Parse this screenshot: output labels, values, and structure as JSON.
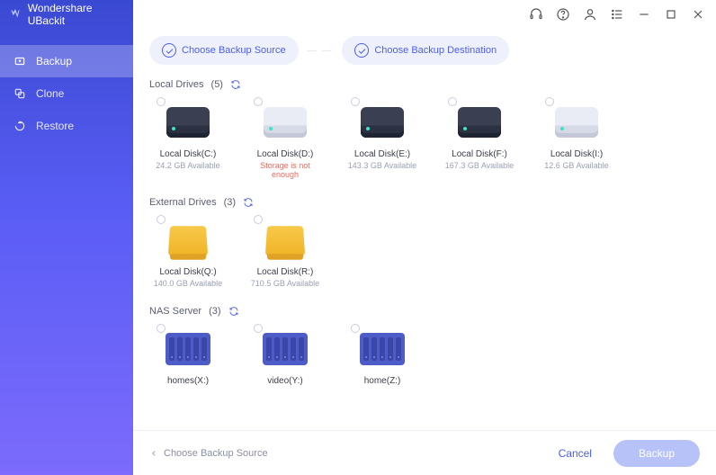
{
  "brand": "Wondershare UBackit",
  "sidebar": {
    "items": [
      {
        "label": "Backup",
        "active": true,
        "icon": "backup"
      },
      {
        "label": "Clone",
        "active": false,
        "icon": "clone"
      },
      {
        "label": "Restore",
        "active": false,
        "icon": "restore"
      }
    ]
  },
  "steps": {
    "step1": "Choose Backup Source",
    "step2": "Choose Backup Destination"
  },
  "sections": {
    "local": {
      "title": "Local Drives",
      "count": "(5)"
    },
    "external": {
      "title": "External Drives",
      "count": "(3)"
    },
    "nas": {
      "title": "NAS Server",
      "count": "(3)"
    }
  },
  "drives": {
    "local": [
      {
        "name": "Local Disk(C:)",
        "sub": "24.2 GB Available",
        "variant": "dark",
        "err": false
      },
      {
        "name": "Local Disk(D:)",
        "sub": "Storage is not enough",
        "variant": "light",
        "err": true
      },
      {
        "name": "Local Disk(E:)",
        "sub": "143.3 GB Available",
        "variant": "dark",
        "err": false
      },
      {
        "name": "Local Disk(F:)",
        "sub": "167.3 GB Available",
        "variant": "dark",
        "err": false
      },
      {
        "name": "Local Disk(I:)",
        "sub": "12.6 GB Available",
        "variant": "light",
        "err": false
      }
    ],
    "external": [
      {
        "name": "Local Disk(Q:)",
        "sub": "140.0 GB Available"
      },
      {
        "name": "Local Disk(R:)",
        "sub": "710.5 GB Available"
      }
    ],
    "nas": [
      {
        "name": "homes(X:)"
      },
      {
        "name": "video(Y:)"
      },
      {
        "name": "home(Z:)"
      }
    ]
  },
  "footer": {
    "crumb": "Choose Backup Source",
    "cancel": "Cancel",
    "primary": "Backup"
  }
}
